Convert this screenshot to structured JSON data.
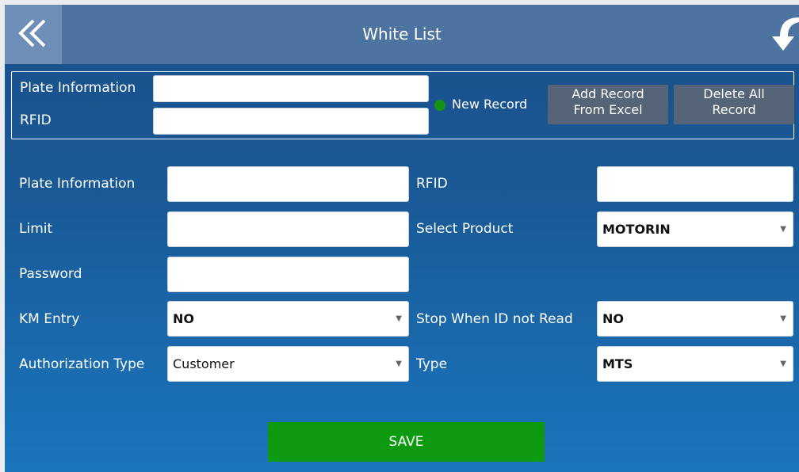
{
  "header": {
    "title": "White List",
    "back_icon": "double-chevron-left-icon",
    "refresh_icon": "curved-arrow-down-icon"
  },
  "search": {
    "plate_label": "Plate Information",
    "rfid_label": "RFID",
    "plate_value": "",
    "rfid_value": "",
    "new_record_label": "New Record",
    "add_from_excel_label": "Add Record\nFrom Excel",
    "delete_all_label": "Delete All\nRecord"
  },
  "form": {
    "plate_label": "Plate Information",
    "plate_value": "",
    "rfid_label": "RFID",
    "rfid_value": "",
    "limit_label": "Limit",
    "limit_value": "",
    "select_product_label": "Select Product",
    "select_product_value": "MOTORIN",
    "password_label": "Password",
    "password_value": "",
    "km_entry_label": "KM Entry",
    "km_entry_value": "NO",
    "stop_label": "Stop When ID not Read",
    "stop_value": "NO",
    "auth_type_label": "Authorization Type",
    "auth_type_value": "Customer",
    "type_label": "Type",
    "type_value": "MTS"
  },
  "save_label": "SAVE",
  "colors": {
    "header": "#4d74a1",
    "back_button": "#6d8fb7",
    "save_button": "#0e9a10",
    "status_dot": "#149314",
    "grey_button": "#556577"
  }
}
